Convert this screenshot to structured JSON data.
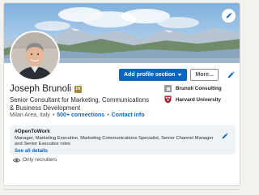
{
  "profile": {
    "name": "Joseph Brunoli",
    "badge": "in",
    "headline": "Senior Consultant for Marketing, Communications & Business Development",
    "location": "Milan Area, Italy",
    "separator": "•",
    "connections": "500+ connections",
    "contact_info": "Contact info"
  },
  "actions": {
    "add_section_label": "Add profile section",
    "more_label": "More..."
  },
  "companies": [
    {
      "name": "Brunoli Consulting",
      "logo": "company-square-icon"
    },
    {
      "name": "Harvard University",
      "logo": "harvard-shield-icon"
    }
  ],
  "open_to_work": {
    "title": "#OpenToWork",
    "roles": "Manager, Marketing Executive, Marketing Communications Specialist, Senior Channel Manager and Senior Executive roles",
    "see_all": "See all details"
  },
  "visibility": {
    "label": "Only recruiters",
    "icon": "eye-icon"
  },
  "colors": {
    "accent": "#0a66c2",
    "premium_badge": "#a68a34",
    "otw_background": "#eef3f8"
  }
}
